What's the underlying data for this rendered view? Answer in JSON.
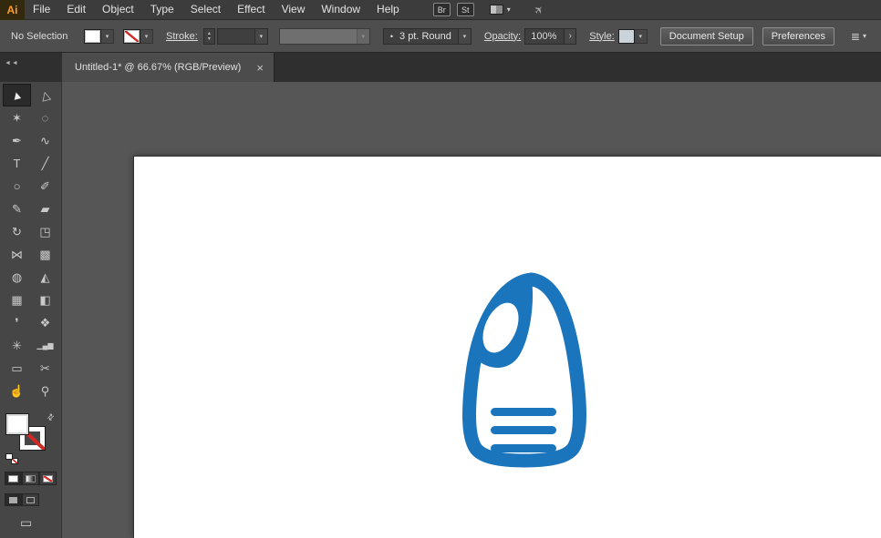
{
  "app": {
    "logo_text": "Ai"
  },
  "menubar": {
    "items": [
      "File",
      "Edit",
      "Object",
      "Type",
      "Select",
      "Effect",
      "View",
      "Window",
      "Help"
    ],
    "bridge_label": "Br",
    "stock_label": "St"
  },
  "control_bar": {
    "selection_status": "No Selection",
    "stroke_label": "Stroke:",
    "brush_bullet": "•",
    "brush_value": "3 pt. Round",
    "opacity_label": "Opacity:",
    "opacity_value": "100%",
    "style_label": "Style:",
    "document_setup_label": "Document Setup",
    "preferences_label": "Preferences"
  },
  "tabbar": {
    "collapse_glyph": "◄◄",
    "title": "Untitled-1* @ 66.67% (RGB/Preview)",
    "close_glyph": "×"
  },
  "toolbar": {
    "tools": [
      {
        "name": "selection-tool",
        "glyph": "▲"
      },
      {
        "name": "direct-selection-tool",
        "glyph": "△"
      },
      {
        "name": "magic-wand-tool",
        "glyph": "✶"
      },
      {
        "name": "lasso-tool",
        "glyph": "◌"
      },
      {
        "name": "pen-tool",
        "glyph": "✒"
      },
      {
        "name": "curvature-tool",
        "glyph": "∿"
      },
      {
        "name": "type-tool",
        "glyph": "T"
      },
      {
        "name": "line-segment-tool",
        "glyph": "╱"
      },
      {
        "name": "ellipse-tool",
        "glyph": "○"
      },
      {
        "name": "paintbrush-tool",
        "glyph": "✐"
      },
      {
        "name": "pencil-tool",
        "glyph": "✎"
      },
      {
        "name": "eraser-tool",
        "glyph": "▰"
      },
      {
        "name": "rotate-tool",
        "glyph": "↻"
      },
      {
        "name": "scale-tool",
        "glyph": "◳"
      },
      {
        "name": "width-tool",
        "glyph": "⋈"
      },
      {
        "name": "free-transform-tool",
        "glyph": "▩"
      },
      {
        "name": "shape-builder-tool",
        "glyph": "◍"
      },
      {
        "name": "perspective-grid-tool",
        "glyph": "◭"
      },
      {
        "name": "mesh-tool",
        "glyph": "▦"
      },
      {
        "name": "gradient-tool",
        "glyph": "◧"
      },
      {
        "name": "eyedropper-tool",
        "glyph": "❜"
      },
      {
        "name": "blend-tool",
        "glyph": "❖"
      },
      {
        "name": "symbol-sprayer-tool",
        "glyph": "✳"
      },
      {
        "name": "column-graph-tool",
        "glyph": "▁▄▆"
      },
      {
        "name": "artboard-tool",
        "glyph": "▭"
      },
      {
        "name": "slice-tool",
        "glyph": "✂"
      },
      {
        "name": "hand-tool",
        "glyph": "☝"
      },
      {
        "name": "zoom-tool",
        "glyph": "⚲"
      }
    ]
  },
  "icons": {
    "chevron_down": "▾",
    "stepper_up": "▴",
    "stepper_down": "▾",
    "arrow_right": "›",
    "swap_arrow": "⇄",
    "screen_mode": "▭",
    "gpu": "✈",
    "arrange": "≣"
  },
  "canvas": {
    "logo_color": "#1b75bc"
  },
  "colors": {
    "none_slash_red": "#cf2b24",
    "ui_dark": "#3c3c3c",
    "artboard_white": "#ffffff"
  }
}
